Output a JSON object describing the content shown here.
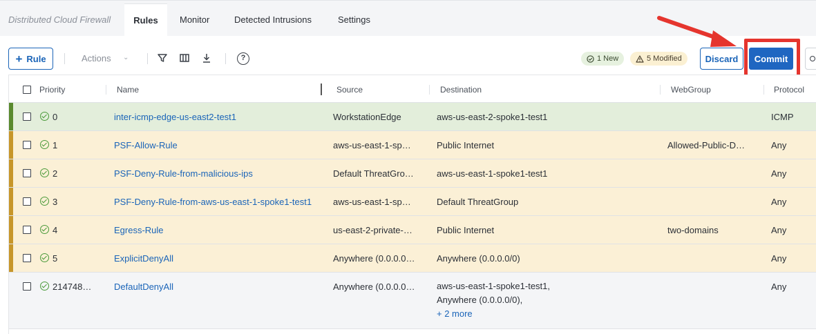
{
  "app": {
    "title": "Distributed Cloud Firewall"
  },
  "tabs": [
    {
      "label": "Rules",
      "active": true
    },
    {
      "label": "Monitor"
    },
    {
      "label": "Detected Intrusions"
    },
    {
      "label": "Settings"
    }
  ],
  "toolbar": {
    "add_rule_label": "Rule",
    "actions_label": "Actions",
    "icons": [
      "filter-icon",
      "columns-icon",
      "download-icon",
      "help-icon"
    ],
    "help_glyph": "?",
    "new_badge": "1 New",
    "modified_badge": "5 Modified",
    "discard_label": "Discard",
    "commit_label": "Commit"
  },
  "table": {
    "columns": [
      "Priority",
      "Name",
      "Source",
      "Destination",
      "WebGroup",
      "Protocol"
    ],
    "rows": [
      {
        "state": "new",
        "priority": "0",
        "name": "inter-icmp-edge-us-east2-test1",
        "source": "WorkstationEdge",
        "destination": "aws-us-east-2-spoke1-test1",
        "webgroup": "",
        "protocol": "ICMP"
      },
      {
        "state": "modified",
        "priority": "1",
        "name": "PSF-Allow-Rule",
        "source": "aws-us-east-1-sp…",
        "destination": "Public Internet",
        "webgroup": "Allowed-Public-D…",
        "protocol": "Any"
      },
      {
        "state": "modified",
        "priority": "2",
        "name": "PSF-Deny-Rule-from-malicious-ips",
        "source": "Default ThreatGro…",
        "destination": "aws-us-east-1-spoke1-test1",
        "webgroup": "",
        "protocol": "Any"
      },
      {
        "state": "modified",
        "priority": "3",
        "name": "PSF-Deny-Rule-from-aws-us-east-1-spoke1-test1",
        "source": "aws-us-east-1-sp…",
        "destination": "Default ThreatGroup",
        "webgroup": "",
        "protocol": "Any"
      },
      {
        "state": "modified",
        "priority": "4",
        "name": "Egress-Rule",
        "source": "us-east-2-private-…",
        "destination": "Public Internet",
        "webgroup": "two-domains",
        "protocol": "Any"
      },
      {
        "state": "modified",
        "priority": "5",
        "name": "ExplicitDenyAll",
        "source": "Anywhere (0.0.0.0…",
        "destination": "Anywhere (0.0.0.0/0)",
        "webgroup": "",
        "protocol": "Any"
      },
      {
        "state": "committed",
        "priority": "214748…",
        "name": "DefaultDenyAll",
        "source": "Anywhere (0.0.0.0…",
        "destination_lines": [
          "aws-us-east-1-spoke1-test1,",
          "Anywhere (0.0.0.0/0),"
        ],
        "destination_more": "+ 2 more",
        "webgroup": "",
        "protocol": "Any"
      }
    ]
  },
  "colors": {
    "accent": "#1f66c1",
    "new_row": "#e3eedb",
    "modified_row": "#fbf0d6",
    "highlight": "#e5352e"
  }
}
